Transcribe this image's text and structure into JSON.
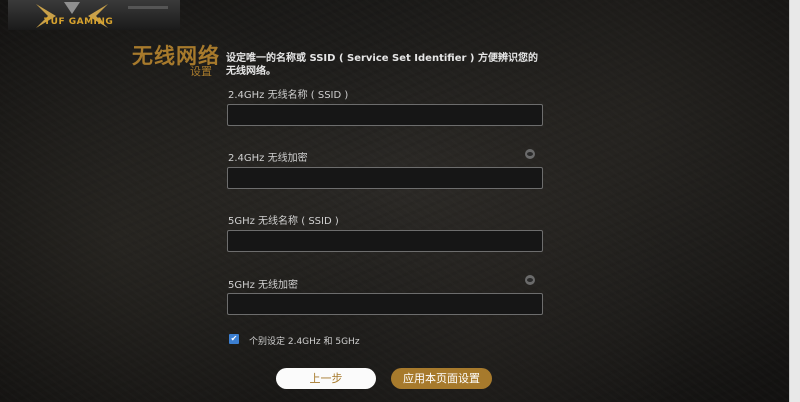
{
  "logo": {
    "text": "TUF GAMING"
  },
  "header": {
    "title": "无线网络",
    "subtitle": "设置",
    "description": "设定唯一的名称或 SSID ( Service Set Identifier ) 方便辨识您的无线网络。"
  },
  "fields": {
    "ssid_24": {
      "label": "2.4GHz 无线名称 ( SSID )",
      "value": ""
    },
    "key_24": {
      "label": "2.4GHz 无线加密",
      "value": ""
    },
    "ssid_5": {
      "label": "5GHz 无线名称 ( SSID )",
      "value": ""
    },
    "key_5": {
      "label": "5GHz 无线加密",
      "value": ""
    }
  },
  "separate_setting": {
    "label": "个别设定 2.4GHz 和 5GHz",
    "checked": true
  },
  "buttons": {
    "prev": "上一步",
    "apply": "应用本页面设置"
  },
  "colors": {
    "accent": "#a77a2c",
    "checkbox": "#3c7fd1"
  },
  "icons": {
    "password_toggle": "eye-icon"
  }
}
